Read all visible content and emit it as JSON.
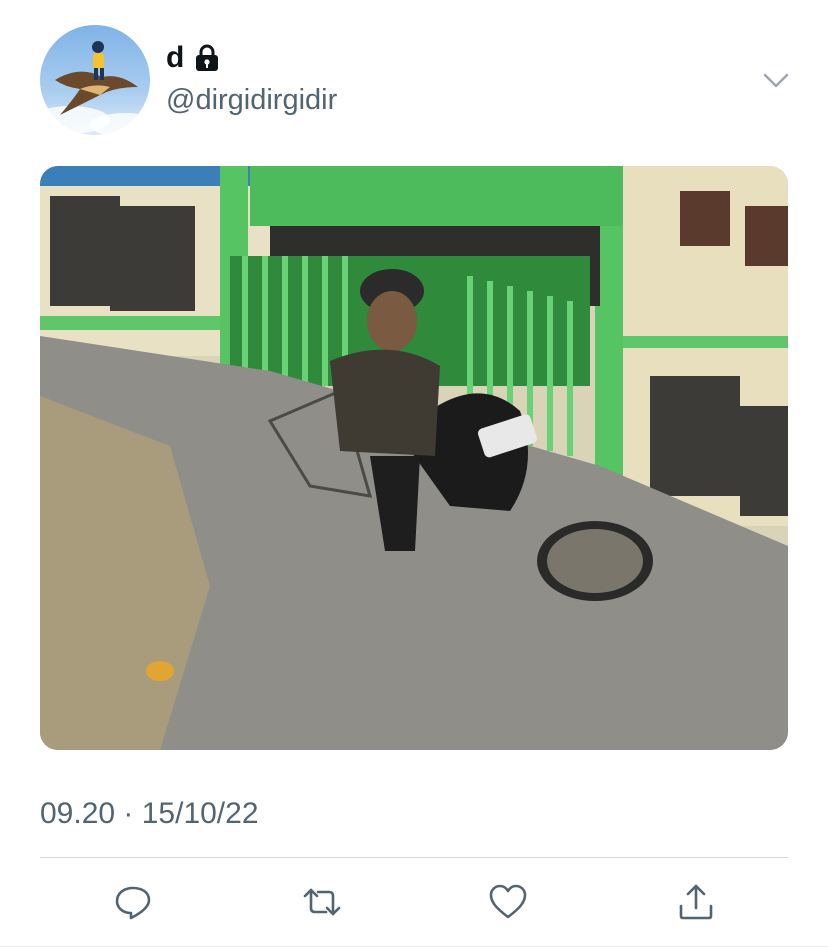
{
  "tweet": {
    "author": {
      "display_name": "d",
      "handle": "@dirgidirgidir",
      "protected_icon": "lock-icon",
      "avatar": "bird-rider-avatar"
    },
    "menu_icon": "chevron-down-icon",
    "media": {
      "description_icon": "photo"
    },
    "timestamp": "09.20 · 15/10/22",
    "actions": {
      "reply": "reply-icon",
      "retweet": "retweet-icon",
      "like": "heart-icon",
      "share": "share-icon"
    }
  },
  "colors": {
    "text_primary": "#0f1419",
    "text_secondary": "#536471",
    "divider": "#cfd9de",
    "icon": "#536471"
  }
}
